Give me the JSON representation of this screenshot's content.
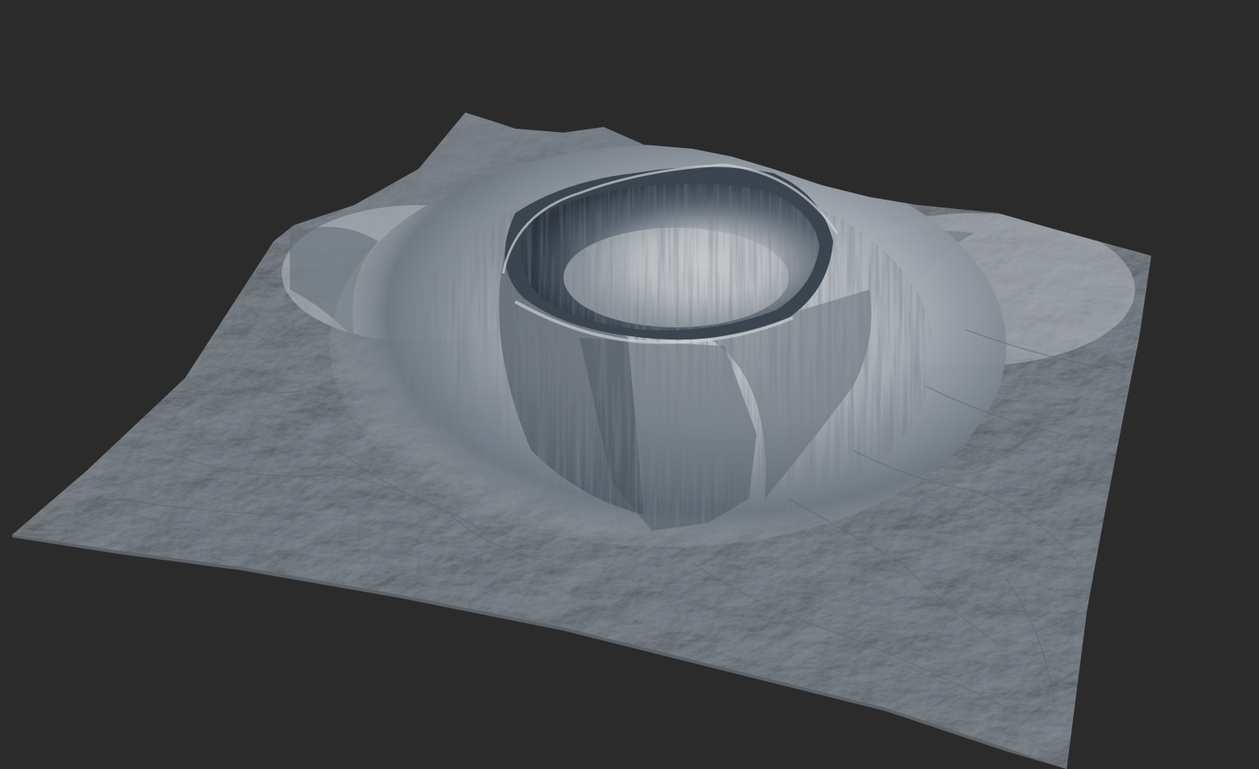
{
  "scene": {
    "background_color": "#2b2b2b",
    "terrain_base_color": "#a3a9ae",
    "terrain_light_color": "#c8ccd0",
    "terrain_shadow_color": "#3c4550",
    "crater_floor_color": "#b9bdc1",
    "crater_wall_dark_color": "#2f3844"
  }
}
